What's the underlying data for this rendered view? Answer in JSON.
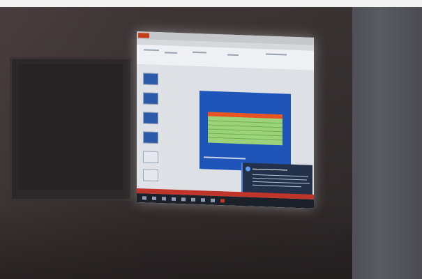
{
  "scene": {
    "description_colors": {
      "wall": "#3e3536",
      "screen_glow": "#e8ebef",
      "slide_bg": "#1f55b8",
      "slide_title": "#f7e05a",
      "table_header": "#e8541f",
      "table_body": "#9bd27a",
      "status_bar": "#c0352a",
      "toast_bg": "#23324a",
      "taskbar": "#1c2129"
    }
  },
  "presentation_app": {
    "thumbnail_count": 6,
    "slide": {
      "title_lines": []
    },
    "notification": {
      "visible": true
    },
    "taskbar_icon_count": 9
  }
}
